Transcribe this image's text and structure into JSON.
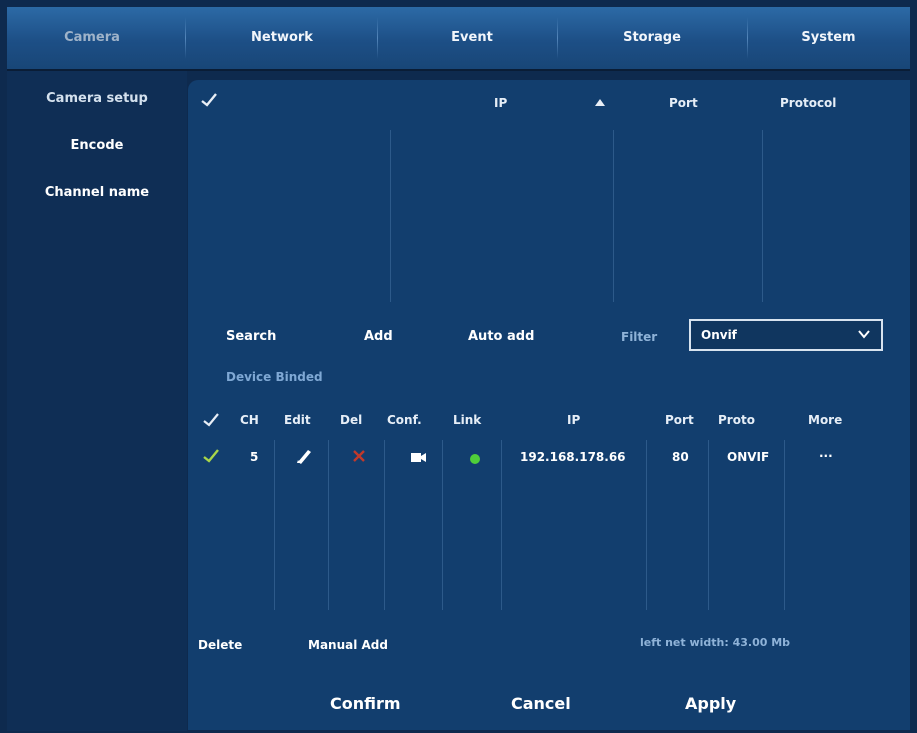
{
  "tabs": [
    {
      "label": "Camera",
      "active": true
    },
    {
      "label": "Network",
      "active": false
    },
    {
      "label": "Event",
      "active": false
    },
    {
      "label": "Storage",
      "active": false
    },
    {
      "label": "System",
      "active": false
    }
  ],
  "sidebar": {
    "items": [
      {
        "label": "Camera setup",
        "active": true
      },
      {
        "label": "Encode",
        "active": false
      },
      {
        "label": "Channel name",
        "active": false
      }
    ]
  },
  "search_table": {
    "select_all_icon": "checkmark-icon",
    "headers": {
      "ip": "IP",
      "port": "Port",
      "protocol": "Protocol"
    },
    "sort_icon": "sort-up-icon",
    "rows": []
  },
  "actions": {
    "search": "Search",
    "add": "Add",
    "auto_add": "Auto add",
    "filter_label": "Filter",
    "filter_value": "Onvif"
  },
  "bound_section": {
    "title": "Device Binded",
    "headers": {
      "ch": "CH",
      "edit": "Edit",
      "del": "Del",
      "conf": "Conf.",
      "link": "Link",
      "ip": "IP",
      "port": "Port",
      "proto": "Proto",
      "more": "More"
    },
    "rows": [
      {
        "checked": true,
        "ch": "5",
        "ip": "192.168.178.66",
        "port": "80",
        "proto": "ONVIF",
        "more": "...",
        "link_status_color": "#4fcf3a"
      }
    ]
  },
  "bottom_actions": {
    "delete": "Delete",
    "manual_add": "Manual Add",
    "bandwidth_text": "left net width: 43.00 Mb"
  },
  "footer": {
    "confirm": "Confirm",
    "cancel": "Cancel",
    "apply": "Apply"
  },
  "colors": {
    "background": "#0e2a4e",
    "panel": "#123e6e",
    "tabbar": "#2c6aa6",
    "delete_red": "#c0392b",
    "link_green": "#4fcf3a"
  }
}
